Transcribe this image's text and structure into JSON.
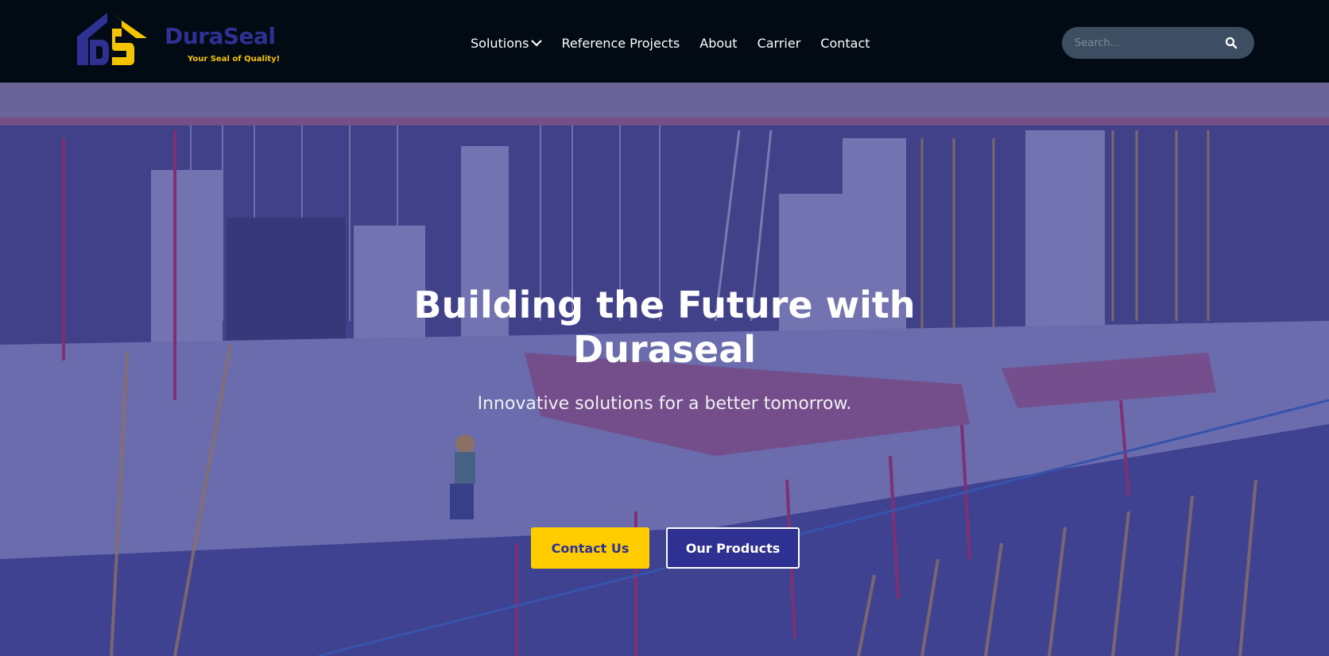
{
  "brand": {
    "name": "DuraSeal",
    "tagline": "Your Seal of Quality!",
    "logo_icon": "duraseal-house-logo-icon",
    "primary_color": "#2e3192",
    "accent_color": "#ffcc00"
  },
  "nav": {
    "items": [
      {
        "label": "Solutions",
        "has_dropdown": true
      },
      {
        "label": "Reference Projects"
      },
      {
        "label": "About"
      },
      {
        "label": "Carrier"
      },
      {
        "label": "Contact"
      }
    ]
  },
  "search": {
    "placeholder": "Search...",
    "icon": "search-icon"
  },
  "hero": {
    "title": "Building the Future with Duraseal",
    "subtitle": "Innovative solutions for a better tomorrow.",
    "primary_button": "Contact Us",
    "secondary_button": "Our Products",
    "background": "construction-site-photo"
  }
}
